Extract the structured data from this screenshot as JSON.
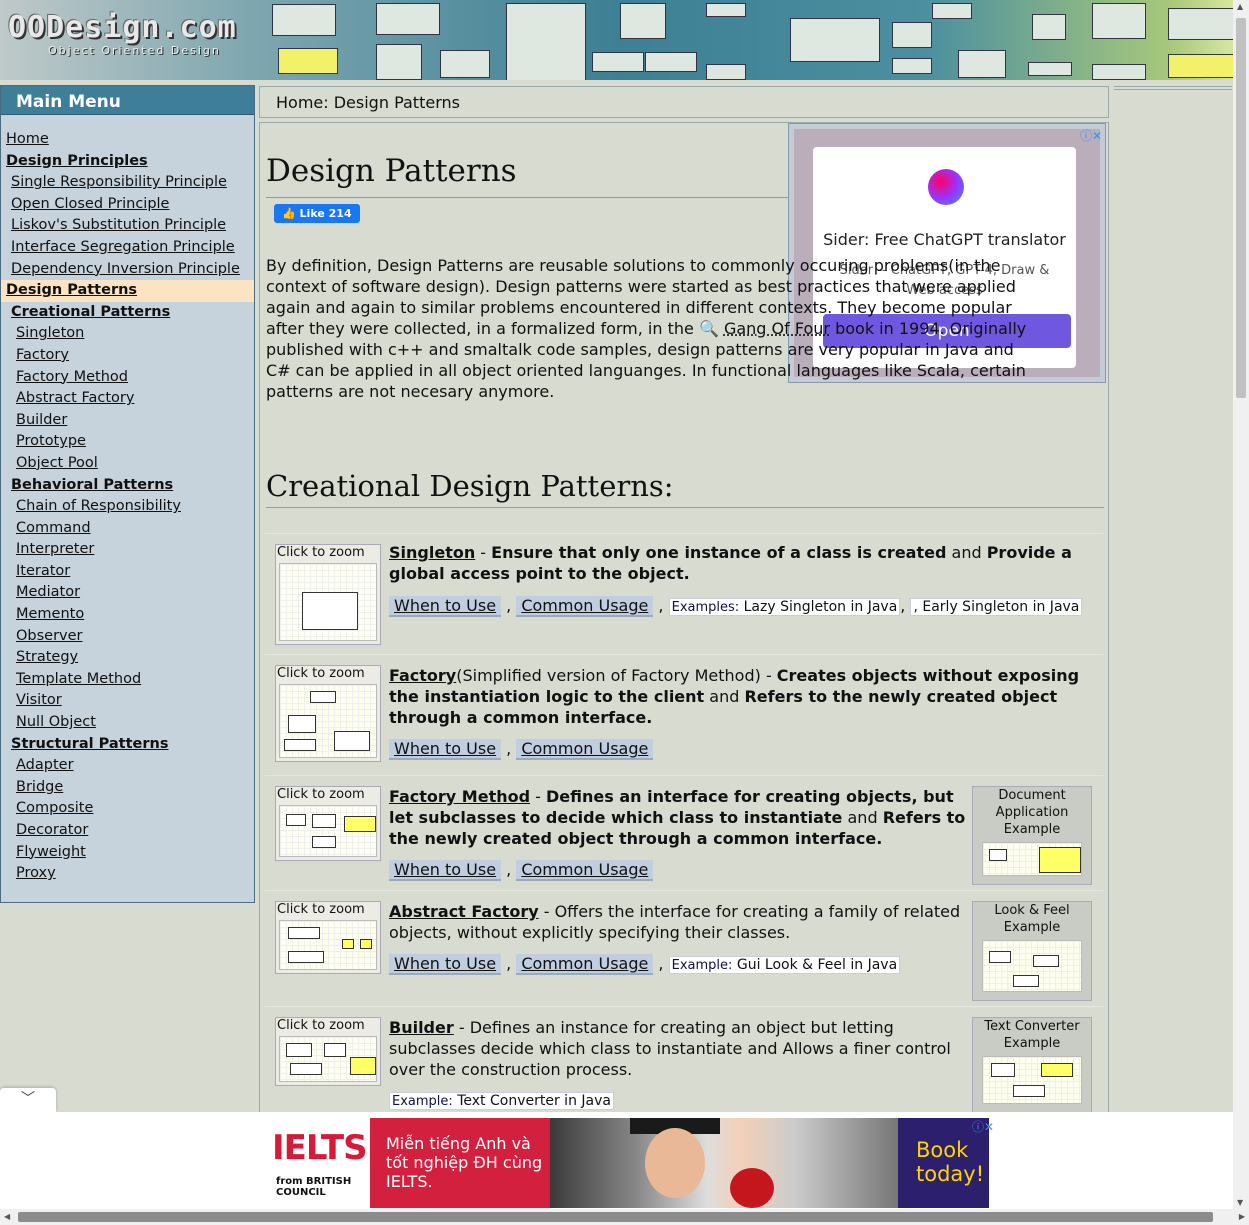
{
  "site": {
    "logo": "OODesign.com",
    "logo_sub": "Object Oriented Design"
  },
  "menu": {
    "title": "Main Menu",
    "items": [
      {
        "label": "Home",
        "level": 0,
        "bold": false
      },
      {
        "label": "Design Principles",
        "level": 0,
        "bold": true
      },
      {
        "label": "Single Responsibility Principle",
        "level": 1,
        "bold": false
      },
      {
        "label": "Open Closed Principle",
        "level": 1,
        "bold": false
      },
      {
        "label": "Liskov's Substitution Principle",
        "level": 1,
        "bold": false
      },
      {
        "label": "Interface Segregation Principle",
        "level": 1,
        "bold": false
      },
      {
        "label": "Dependency Inversion Principle",
        "level": 1,
        "bold": false
      },
      {
        "label": "Design Patterns",
        "level": 0,
        "bold": true,
        "active": true
      },
      {
        "label": "Creational Patterns",
        "level": 1,
        "bold": true
      },
      {
        "label": "Singleton",
        "level": 2,
        "bold": false
      },
      {
        "label": "Factory",
        "level": 2,
        "bold": false
      },
      {
        "label": "Factory Method",
        "level": 2,
        "bold": false
      },
      {
        "label": "Abstract Factory",
        "level": 2,
        "bold": false
      },
      {
        "label": "Builder",
        "level": 2,
        "bold": false
      },
      {
        "label": "Prototype",
        "level": 2,
        "bold": false
      },
      {
        "label": "Object Pool",
        "level": 2,
        "bold": false
      },
      {
        "label": "Behavioral Patterns",
        "level": 1,
        "bold": true
      },
      {
        "label": "Chain of Responsibility",
        "level": 2,
        "bold": false
      },
      {
        "label": "Command",
        "level": 2,
        "bold": false
      },
      {
        "label": "Interpreter",
        "level": 2,
        "bold": false
      },
      {
        "label": "Iterator",
        "level": 2,
        "bold": false
      },
      {
        "label": "Mediator",
        "level": 2,
        "bold": false
      },
      {
        "label": "Memento",
        "level": 2,
        "bold": false
      },
      {
        "label": "Observer",
        "level": 2,
        "bold": false
      },
      {
        "label": "Strategy",
        "level": 2,
        "bold": false
      },
      {
        "label": "Template Method",
        "level": 2,
        "bold": false
      },
      {
        "label": "Visitor",
        "level": 2,
        "bold": false
      },
      {
        "label": "Null Object",
        "level": 2,
        "bold": false
      },
      {
        "label": "Structural Patterns",
        "level": 1,
        "bold": true
      },
      {
        "label": "Adapter",
        "level": 2,
        "bold": false
      },
      {
        "label": "Bridge",
        "level": 2,
        "bold": false
      },
      {
        "label": "Composite",
        "level": 2,
        "bold": false
      },
      {
        "label": "Decorator",
        "level": 2,
        "bold": false
      },
      {
        "label": "Flyweight",
        "level": 2,
        "bold": false
      },
      {
        "label": "Proxy",
        "level": 2,
        "bold": false
      }
    ]
  },
  "breadcrumb": {
    "home": "Home:",
    "current": "Design Patterns"
  },
  "page": {
    "title": "Design Patterns",
    "like_label": "Like 214",
    "intro_before": "By definition, Design Patterns are reusable solutions to commonly occuring problems(in the context of software design). Design patterns were started as best practices that were applied again and again to similar problems encountered in different contexts. They become popular after they were collected, in a formalized form, in the ",
    "gof_link": "Gang Of Four",
    "intro_after": " book in 1994. Originally published with c++ and smaltalk code samples, design patterns are very popular in Java and C# can be applied in all object oriented languanges. In functional languages like Scala, certain patterns are not necesary anymore.",
    "section_title": "Creational Design Patterns:"
  },
  "patterns": {
    "zoom_label": "Click to zoom",
    "when_label": "When to Use",
    "usage_label": "Common Usage",
    "singleton": {
      "name": "Singleton",
      "sep": " - ",
      "d1": "Ensure that only one instance of a class is created",
      "d2": " and ",
      "d3": "Provide a global access point to the object.",
      "examples_label": "Examples:",
      "ex1": "Lazy Singleton in Java",
      "ex2": "Early Singleton in Java"
    },
    "factory": {
      "name": "Factory",
      "d0": "(Simplified version of Factory Method) - ",
      "d1": "Creates objects without exposing the instantiation logic to the client",
      "d2": " and ",
      "d3": "Refers to the newly created object through a common interface."
    },
    "factory_method": {
      "name": "Factory Method",
      "sep": " - ",
      "d1": "Defines an interface for creating objects, but let subclasses to decide which class to instantiate",
      "d2": " and ",
      "d3": "Refers to the newly created object through a common interface.",
      "side_label": "Document Application Example"
    },
    "abstract_factory": {
      "name": "Abstract Factory",
      "d1": " - Offers the interface for creating a family of related objects, without explicitly specifying their classes.",
      "example_label": "Example:",
      "ex1": "Gui Look & Feel in Java",
      "side_label": "Look & Feel Example"
    },
    "builder": {
      "name": "Builder",
      "d1": " - Defines an instance for creating an object but letting subclasses decide which class to instantiate and Allows a finer control over the construction process.",
      "example_label": "Example:",
      "ex1": "Text Converter in Java",
      "side_label": "Text Converter Example"
    }
  },
  "ad": {
    "title": "Sider: Free ChatGPT translator",
    "desc": "Sider -- ChatGPT, GPT-4, Draw & Web access",
    "button": "Open"
  },
  "bottom_ad": {
    "logo": "IELTS",
    "partner": "from BRITISH COUNCIL",
    "message": "Miễn tiếng Anh và tốt nghiệp ĐH cùng IELTS.",
    "cta": "Book today!"
  },
  "colors": {
    "menu_header": "#3f7e99",
    "sidebar_bg": "#c7d3dc",
    "active_item": "#fbe3c4",
    "page_bg": "#d8dcd0",
    "ad_button": "#6f57e0",
    "ielts_red": "#d4203f"
  }
}
